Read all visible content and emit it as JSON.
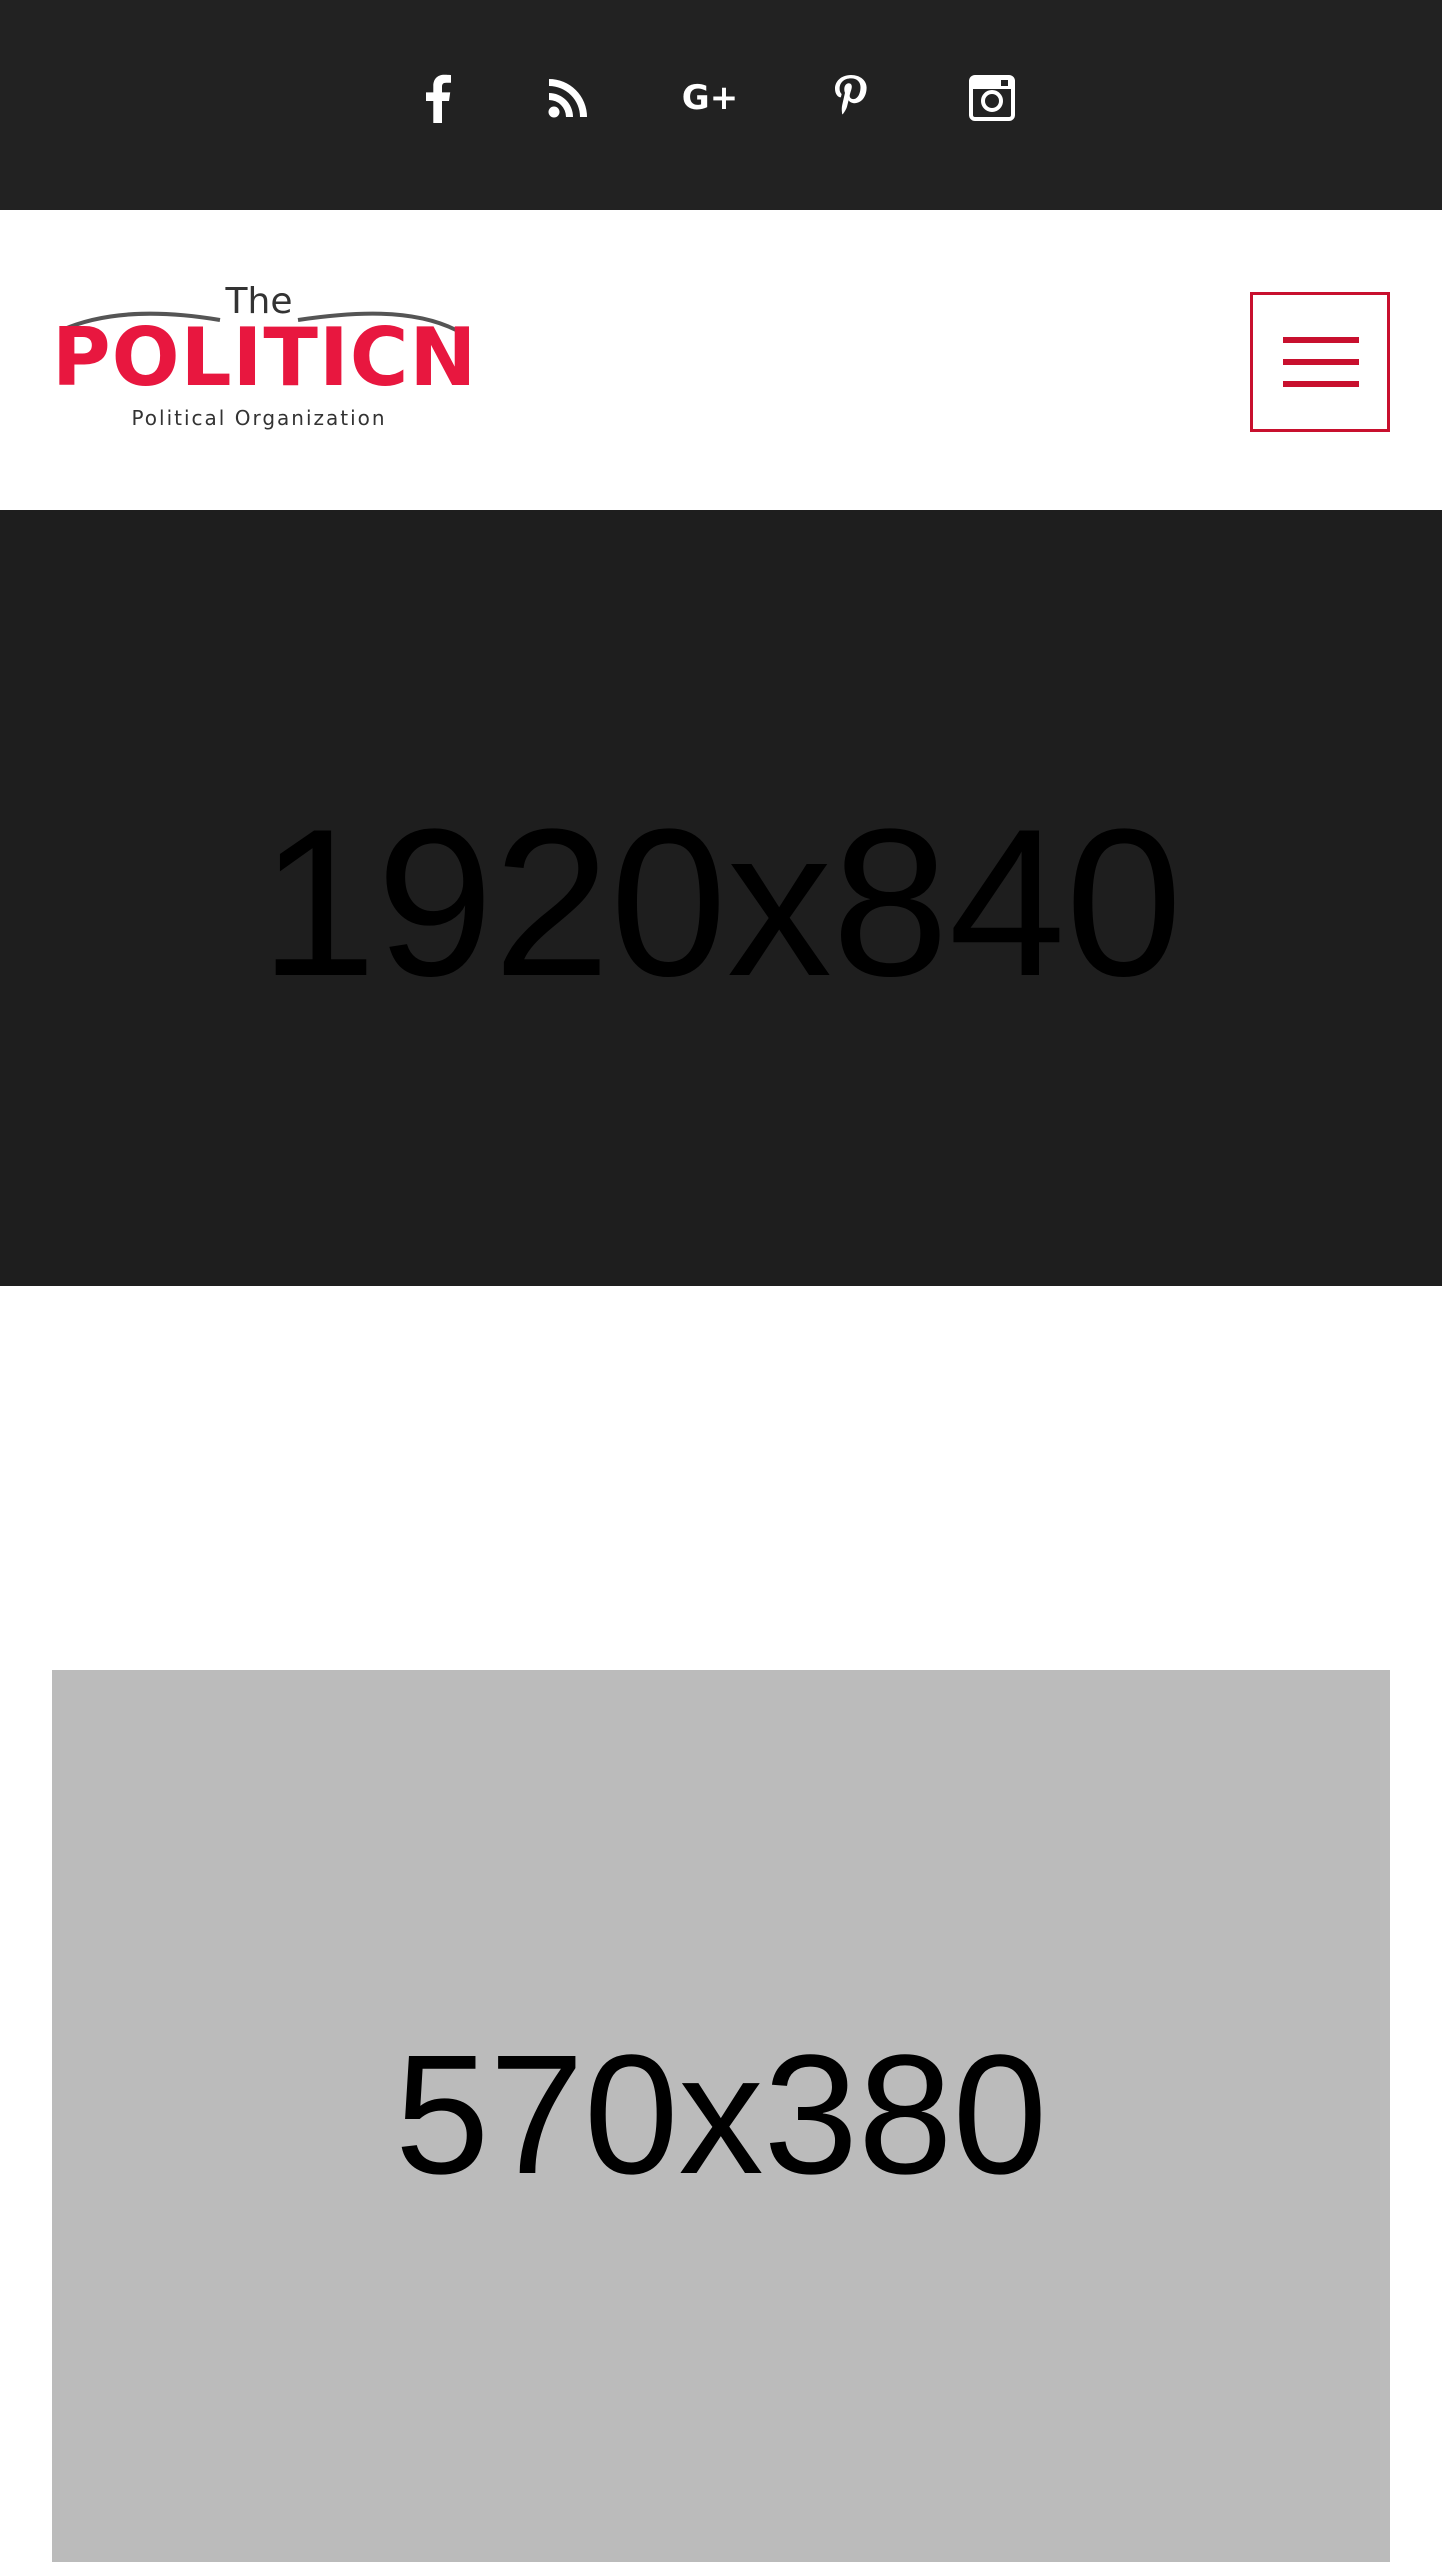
{
  "social": {
    "icons": [
      "facebook-icon",
      "rss-icon",
      "google-plus-icon",
      "pinterest-icon",
      "instagram-icon"
    ],
    "google_plus_glyph": "G+"
  },
  "logo": {
    "the": "The",
    "name": "POLITICN",
    "tagline": "Political Organization"
  },
  "hero": {
    "placeholder": "1920x840"
  },
  "card": {
    "placeholder": "570x380"
  },
  "colors": {
    "topbar_bg": "#222222",
    "hero_bg": "#1e1e1e",
    "brand_red": "#e8173f",
    "menu_red": "#c8102e",
    "card_bg": "#bbbbbb"
  }
}
